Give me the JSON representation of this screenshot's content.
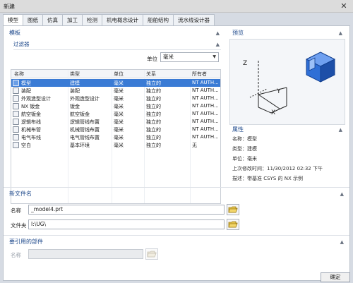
{
  "window": {
    "title": "新建",
    "close_glyph": "✕"
  },
  "tabs": [
    "模型",
    "图纸",
    "仿真",
    "加工",
    "检测",
    "机电概念设计",
    "船舶结构",
    "流水线设计器"
  ],
  "template": {
    "header": "模板",
    "filter_header": "过滤器",
    "unit_label": "单位",
    "unit_value": "毫米",
    "columns": [
      "名称",
      "类型",
      "单位",
      "关系",
      "所有者"
    ],
    "rows": [
      {
        "name": "模型",
        "type": "建模",
        "unit": "毫米",
        "rel": "独立的",
        "owner": "NT AUTH...",
        "selected": true,
        "icon": "model-icon"
      },
      {
        "name": "装配",
        "type": "装配",
        "unit": "毫米",
        "rel": "独立的",
        "owner": "NT AUTH...",
        "selected": false,
        "icon": "assembly-icon"
      },
      {
        "name": "外观造型设计",
        "type": "外观造型设计",
        "unit": "毫米",
        "rel": "独立的",
        "owner": "NT AUTH...",
        "selected": false,
        "icon": "shape-studio-icon"
      },
      {
        "name": "NX 钣金",
        "type": "钣金",
        "unit": "毫米",
        "rel": "独立的",
        "owner": "NT AUTH...",
        "selected": false,
        "icon": "sheet-metal-icon"
      },
      {
        "name": "航空钣金",
        "type": "航空钣金",
        "unit": "毫米",
        "rel": "独立的",
        "owner": "NT AUTH...",
        "selected": false,
        "icon": "aero-sheet-metal-icon"
      },
      {
        "name": "逻辑布线",
        "type": "逻辑管线布置",
        "unit": "毫米",
        "rel": "独立的",
        "owner": "NT AUTH...",
        "selected": false,
        "icon": "logical-routing-icon"
      },
      {
        "name": "机械布管",
        "type": "机械管线布置",
        "unit": "毫米",
        "rel": "独立的",
        "owner": "NT AUTH...",
        "selected": false,
        "icon": "mechanical-routing-icon"
      },
      {
        "name": "电气布线",
        "type": "电气管线布置",
        "unit": "毫米",
        "rel": "独立的",
        "owner": "NT AUTH...",
        "selected": false,
        "icon": "electrical-routing-icon"
      },
      {
        "name": "空白",
        "type": "基本环境",
        "unit": "毫米",
        "rel": "独立的",
        "owner": "无",
        "selected": false,
        "icon": "blank-icon"
      }
    ]
  },
  "preview": {
    "header": "预览",
    "axis_x": "X",
    "axis_y": "Y",
    "axis_z": "Z"
  },
  "properties": {
    "header": "属性",
    "items": [
      "名称：模型",
      "类型：建模",
      "单位：毫米",
      "上次修改时间：11/30/2012 02:32 下午",
      "描述：带基准 CSYS 的 NX 示例"
    ]
  },
  "new_file": {
    "header": "新文件名",
    "name_label": "名称",
    "name_value": "_model4.prt",
    "folder_label": "文件夹",
    "folder_value": "I:\\UG\\"
  },
  "referenced_part": {
    "header": "要引用的部件",
    "name_label": "名称",
    "name_value": ""
  },
  "buttons": {
    "ok": "确定"
  }
}
